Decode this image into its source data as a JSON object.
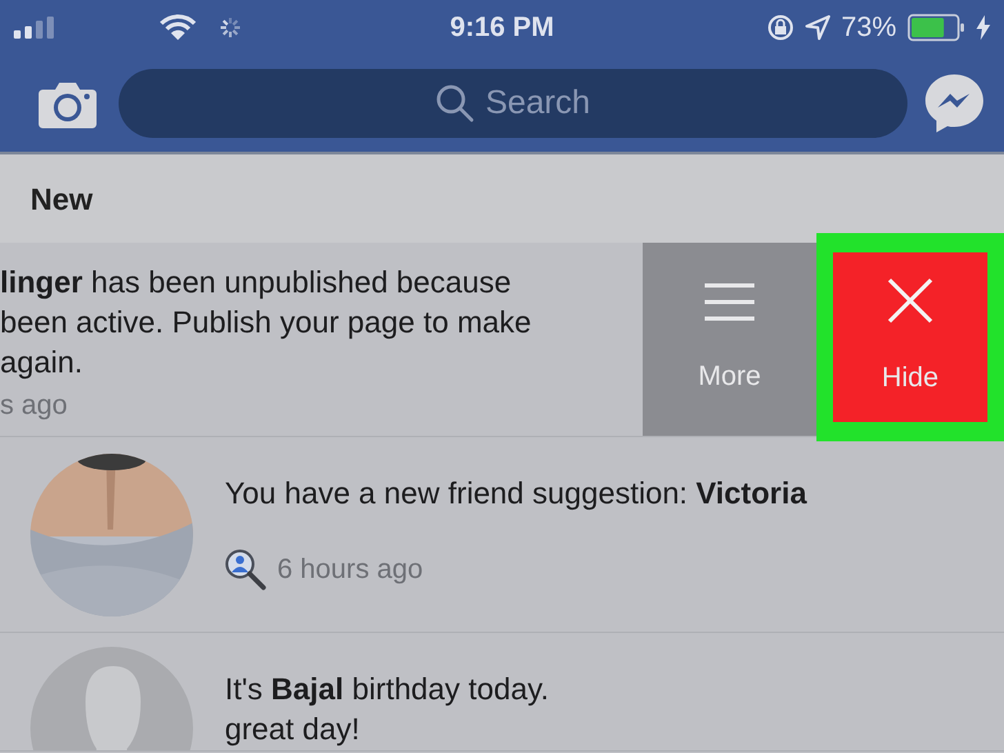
{
  "status_bar": {
    "time": "9:16 PM",
    "battery": "73%"
  },
  "header": {
    "search": {
      "placeholder": "Search"
    }
  },
  "section": {
    "title": "New"
  },
  "notifications": [
    {
      "kind": "swiped",
      "lines": [
        "**linger** has been unpublished because",
        "been active. Publish your page to make",
        "again."
      ],
      "time": "s ago",
      "actions": [
        {
          "kind": "more",
          "label": "More",
          "highlighted": false
        },
        {
          "kind": "hide",
          "label": "Hide",
          "highlighted": true
        }
      ]
    },
    {
      "kind": "friend",
      "avatar": {
        "kind": "picture"
      },
      "lines": [
        "You have a new friend suggestion: **Victoria**"
      ],
      "time": "6 hours ago"
    },
    {
      "kind": "birthday",
      "avatar": {
        "kind": "silhouette"
      },
      "lines": [
        "It's **Bajal** birthday today.",
        "great day!"
      ]
    }
  ]
}
